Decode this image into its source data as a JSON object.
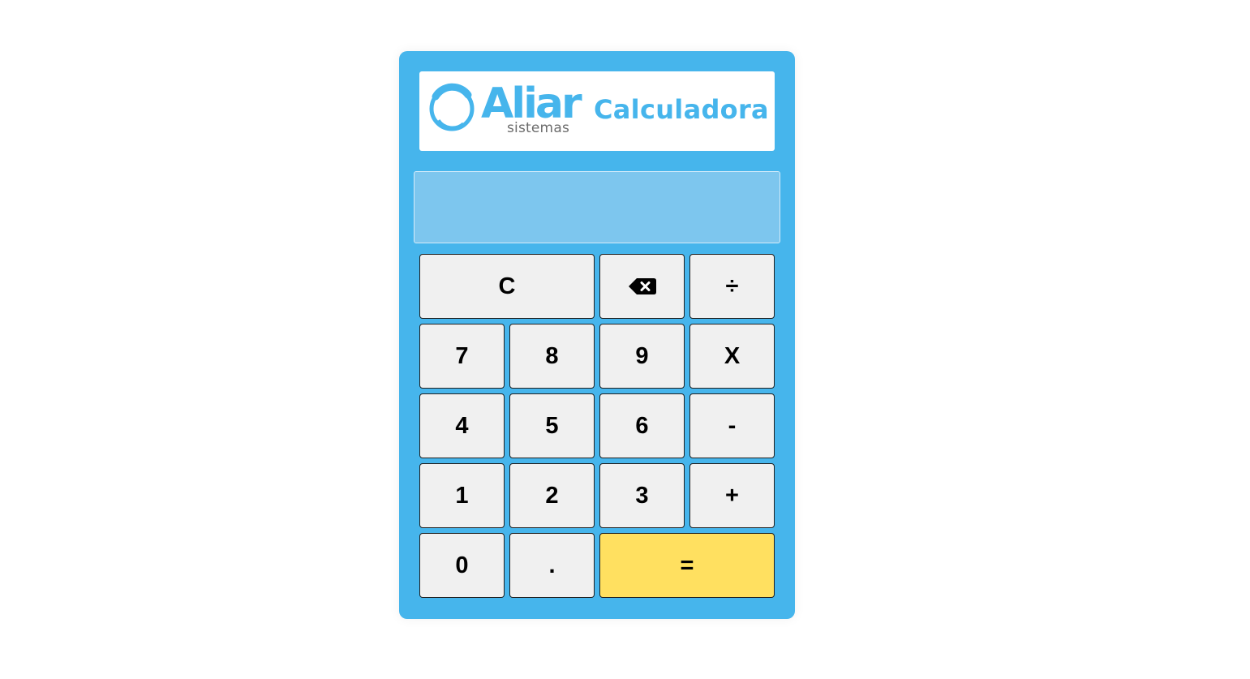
{
  "header": {
    "logo_word": "Aliar",
    "logo_sub": "sistemas",
    "title": "Calculadora"
  },
  "display": {
    "value": ""
  },
  "keys": {
    "clear": "C",
    "backspace_icon": "backspace-icon",
    "divide": "÷",
    "seven": "7",
    "eight": "8",
    "nine": "9",
    "multiply": "X",
    "four": "4",
    "five": "5",
    "six": "6",
    "minus": "-",
    "one": "1",
    "two": "2",
    "three": "3",
    "plus": "+",
    "zero": "0",
    "dot": ".",
    "equals": "="
  },
  "colors": {
    "brand": "#46b5ec",
    "display": "#7dc6ee",
    "key": "#f0f0f0",
    "equals_key": "#ffe060"
  }
}
